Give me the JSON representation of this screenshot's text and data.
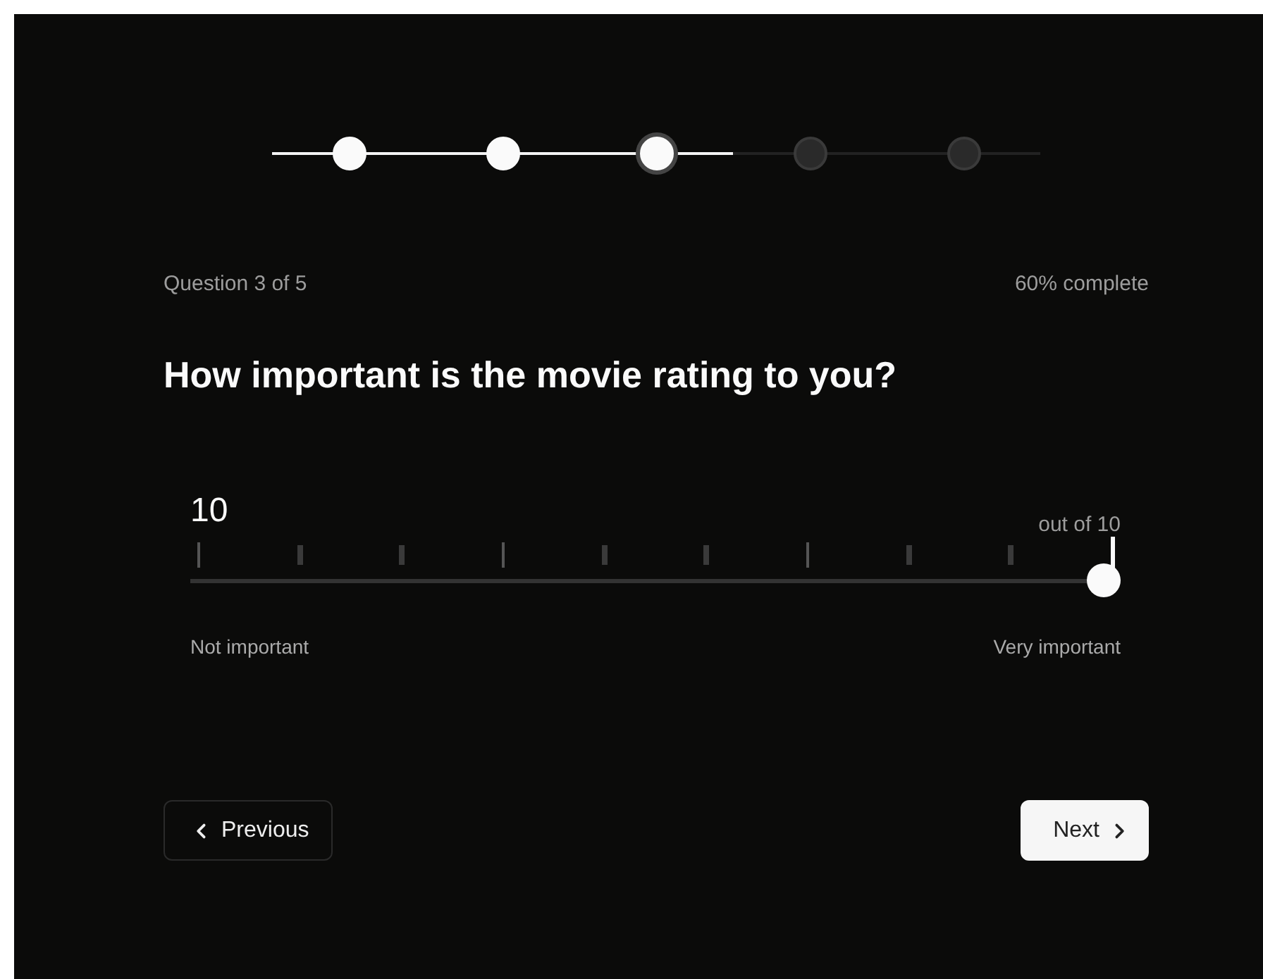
{
  "stepper": {
    "steps": [
      {
        "completed": true,
        "selected": false
      },
      {
        "completed": true,
        "selected": false
      },
      {
        "completed": false,
        "selected": true
      },
      {
        "completed": false,
        "selected": false
      },
      {
        "completed": false,
        "selected": false
      }
    ]
  },
  "progress": {
    "question_label": "Question 3 of 5",
    "percent_label": "60% complete"
  },
  "question": "How important is the movie rating to you?",
  "slider": {
    "value": "10",
    "max_label": "out of 10",
    "level": 1,
    "min_caption": "Not important",
    "max_caption": "Very important"
  },
  "buttons": [
    {
      "label": "Previous",
      "kind": "back"
    },
    {
      "label": "Next",
      "kind": "forward"
    }
  ]
}
